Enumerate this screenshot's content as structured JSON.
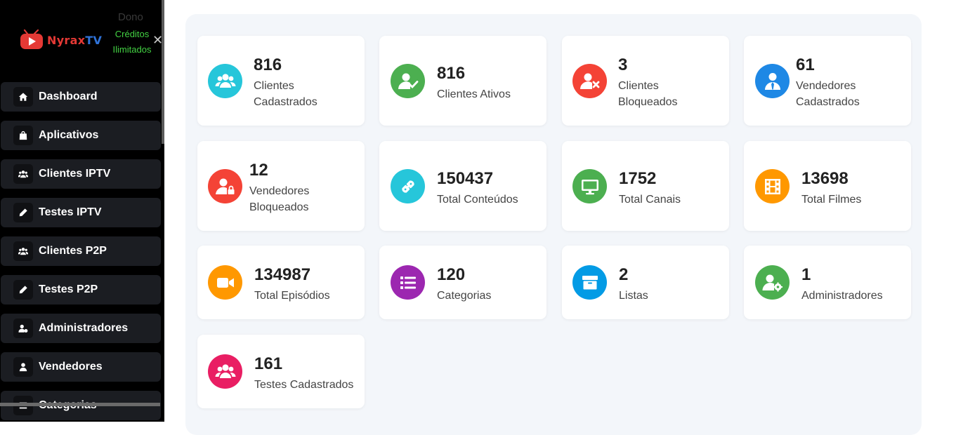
{
  "header": {
    "brand_part1": "Nyrax",
    "brand_part2": "TV",
    "role": "Dono",
    "credits_line1": "Créditos",
    "credits_line2": "Ilimitados",
    "close_symbol": "✕"
  },
  "sidebar": {
    "items": [
      {
        "label": "Dashboard",
        "icon": "home-icon"
      },
      {
        "label": "Aplicativos",
        "icon": "bag-icon"
      },
      {
        "label": "Clientes IPTV",
        "icon": "users-icon"
      },
      {
        "label": "Testes IPTV",
        "icon": "pencil-icon"
      },
      {
        "label": "Clientes P2P",
        "icon": "users-icon"
      },
      {
        "label": "Testes P2P",
        "icon": "pencil-icon"
      },
      {
        "label": "Administradores",
        "icon": "user-gear-icon"
      },
      {
        "label": "Vendedores",
        "icon": "user-icon"
      },
      {
        "label": "Categorias",
        "icon": "list-icon"
      }
    ]
  },
  "stats": [
    {
      "value": "816",
      "label": "Clientes Cadastrados",
      "icon": "users-group-icon",
      "color": "#26c6da"
    },
    {
      "value": "816",
      "label": "Clientes Ativos",
      "icon": "user-check-icon",
      "color": "#4caf50"
    },
    {
      "value": "3",
      "label": "Clientes Bloqueados",
      "icon": "user-x-icon",
      "color": "#f44336"
    },
    {
      "value": "61",
      "label": "Vendedores Cadastrados",
      "icon": "user-tie-icon",
      "color": "#1e88e5"
    },
    {
      "value": "12",
      "label": "Vendedores Bloqueados",
      "icon": "user-lock-icon",
      "color": "#f44336"
    },
    {
      "value": "150437",
      "label": "Total Conteúdos",
      "icon": "link-icon",
      "color": "#26c6da"
    },
    {
      "value": "1752",
      "label": "Total Canais",
      "icon": "tv-icon",
      "color": "#4caf50"
    },
    {
      "value": "13698",
      "label": "Total Filmes",
      "icon": "film-icon",
      "color": "#ff9800"
    },
    {
      "value": "134987",
      "label": "Total Episódios",
      "icon": "video-camera-icon",
      "color": "#ff9800"
    },
    {
      "value": "120",
      "label": "Categorias",
      "icon": "list-icon",
      "color": "#9c27b0"
    },
    {
      "value": "2",
      "label": "Listas",
      "icon": "box-icon",
      "color": "#039be5"
    },
    {
      "value": "1",
      "label": "Administradores",
      "icon": "user-gear-icon",
      "color": "#4caf50"
    },
    {
      "value": "161",
      "label": "Testes Cadastrados",
      "icon": "users-group-icon",
      "color": "#e91e63"
    }
  ],
  "colors": {
    "sidebar_bg": "#000000",
    "nav_item_bg": "#1b1d22",
    "credits_text": "#43d243",
    "main_bg": "#f3f6fa"
  }
}
